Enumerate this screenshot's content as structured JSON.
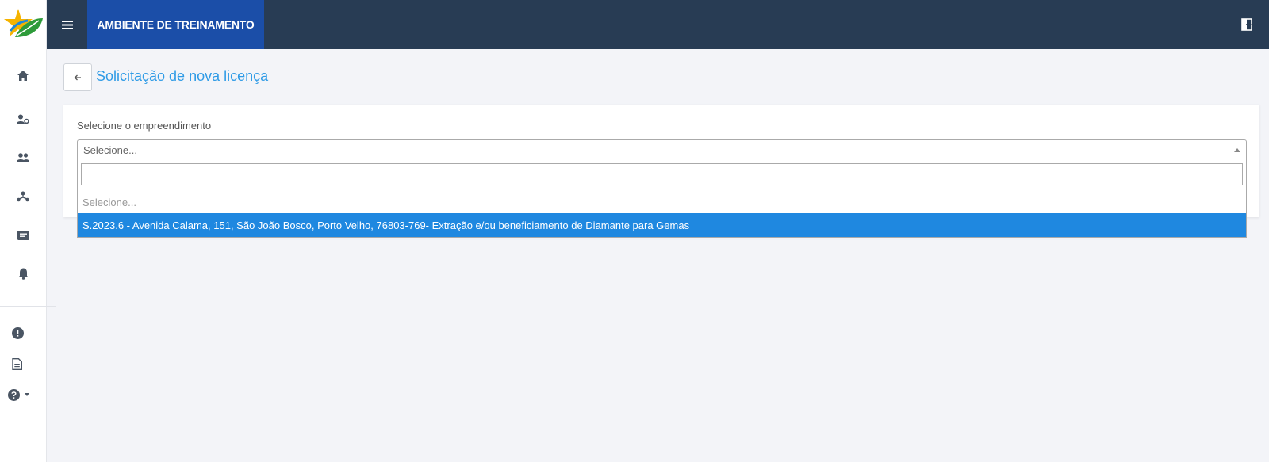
{
  "topbar": {
    "env_label": "AMBIENTE DE TREINAMENTO"
  },
  "icons": {
    "logo": "star-leaf-logo",
    "menu": "hamburger-menu-icon",
    "exit": "exit-door-icon",
    "back": "arrow-left-icon",
    "sidebar": [
      "home-icon",
      "user-settings-icon",
      "users-icon",
      "hierarchy-icon",
      "document-folder-icon",
      "bell-icon",
      "alert-circle-icon",
      "file-text-icon",
      "help-circle-icon"
    ]
  },
  "page": {
    "title": "Solicitação de nova licença"
  },
  "form": {
    "label": "Selecione o empreendimento",
    "select_value": "Selecione...",
    "search_value": "",
    "options": [
      "Selecione...",
      "S.2023.6 - Avenida Calama, 151, São João Bosco, Porto Velho, 76803-769- Extração e/ou beneficiamento de Diamante para Gemas"
    ],
    "highlighted_index": 1
  },
  "colors": {
    "topbar": "#283c54",
    "env_badge": "#1b4ea8",
    "title": "#2f9be6",
    "highlight": "#1f88e0",
    "background": "#f3f4f8"
  }
}
